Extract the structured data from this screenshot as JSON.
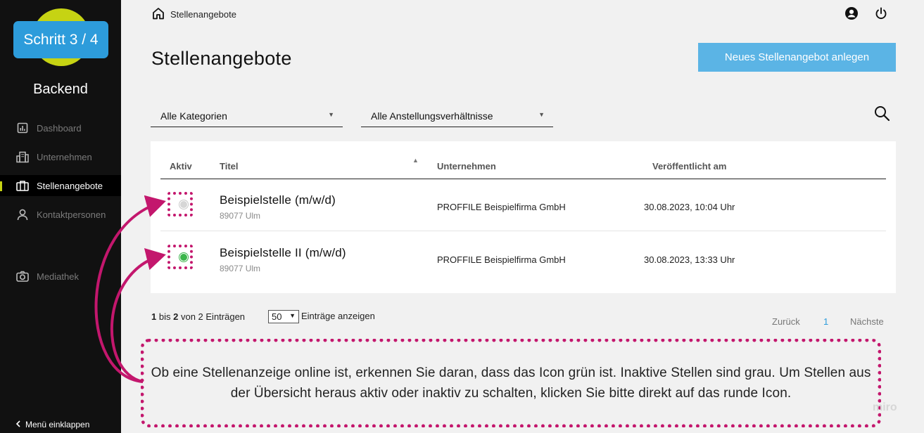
{
  "badge": {
    "step": "Schritt 3 / 4"
  },
  "brand": "Backend",
  "colors": {
    "accent_lime": "#c6d313",
    "primary_blue": "#5bb4e5",
    "highlight_magenta": "#c3176d",
    "active_green": "#3ab54a"
  },
  "sidebar": {
    "items": [
      {
        "label": "Dashboard",
        "icon": "chart-icon"
      },
      {
        "label": "Unternehmen",
        "icon": "building-icon"
      },
      {
        "label": "Stellenangebote",
        "icon": "briefcase-icon",
        "active": true
      },
      {
        "label": "Kontaktpersonen",
        "icon": "person-icon"
      },
      {
        "label": "Mediathek",
        "icon": "camera-icon"
      }
    ],
    "collapse_label": "Menü einklappen"
  },
  "header": {
    "breadcrumb": "Stellenangebote",
    "title": "Stellenangebote",
    "new_button": "Neues Stellenangebot anlegen"
  },
  "filters": {
    "category": "Alle Kategorien",
    "employment": "Alle Anstellungsverhältnisse"
  },
  "table": {
    "columns": [
      "Aktiv",
      "Titel",
      "Unternehmen",
      "Veröffentlicht am"
    ],
    "rows": [
      {
        "active": false,
        "title": "Beispielstelle (m/w/d)",
        "location": "89077 Ulm",
        "company": "PROFFILE Beispielfirma GmbH",
        "published": "30.08.2023, 10:04 Uhr"
      },
      {
        "active": true,
        "title": "Beispielstelle II (m/w/d)",
        "location": "89077 Ulm",
        "company": "PROFFILE Beispielfirma GmbH",
        "published": "30.08.2023, 13:33 Uhr"
      }
    ]
  },
  "footer": {
    "count_from": "1",
    "count_bis": "bis",
    "count_to": "2",
    "count_rest": "von 2 Einträgen",
    "page_size": "50",
    "page_size_label": "Einträge anzeigen",
    "prev": "Zurück",
    "current_page": "1",
    "next": "Nächste"
  },
  "annotation": {
    "text": "Ob eine Stellenanzeige online ist, erkennen Sie daran, dass das Icon grün ist. Inaktive Stellen sind grau. Um Stellen aus der Übersicht heraus aktiv oder inaktiv zu schalten, klicken Sie bitte direkt auf das runde Icon."
  },
  "watermark": "miro"
}
